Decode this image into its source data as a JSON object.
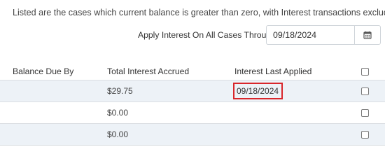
{
  "info_text": "Listed are the cases which current balance is greater than zero, with Interest transactions excluded.",
  "apply": {
    "label": "Apply Interest On All Cases Through",
    "date_value": "09/18/2024",
    "calendar_icon": "calendar-icon"
  },
  "table": {
    "headers": {
      "balance_due_by": "Balance Due By",
      "total_interest_accrued": "Total Interest Accrued",
      "interest_last_applied": "Interest Last Applied"
    },
    "rows": [
      {
        "balance_due_by": "",
        "total_interest_accrued": "$29.75",
        "interest_last_applied": "09/18/2024",
        "checked": false
      },
      {
        "balance_due_by": "",
        "total_interest_accrued": "$0.00",
        "interest_last_applied": "",
        "checked": false
      },
      {
        "balance_due_by": "",
        "total_interest_accrued": "$0.00",
        "interest_last_applied": "",
        "checked": false
      }
    ]
  },
  "colors": {
    "highlight": "#d9262b",
    "row_alt": "#edf2f7",
    "border": "#dadee2"
  }
}
